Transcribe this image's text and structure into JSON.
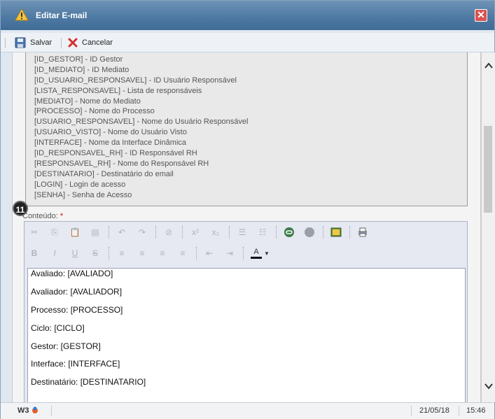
{
  "window": {
    "title": "Editar E-mail"
  },
  "toolbar": {
    "save_label": "Salvar",
    "cancel_label": "Cancelar"
  },
  "variables": [
    "[ID_GESTOR] - ID Gestor",
    "[ID_MEDIATO] - ID Mediato",
    "[ID_USUARIO_RESPONSAVEL] - ID Usuário Responsável",
    "[LISTA_RESPONSAVEL] - Lista de responsáveis",
    "[MEDIATO] - Nome do Mediato",
    "[PROCESSO] - Nome do Processo",
    "[USUARIO_RESPONSAVEL] - Nome do Usuário Responsável",
    "[USUARIO_VISTO] - Nome do Usuário Visto",
    "[INTERFACE] - Nome da Interface Dinâmica",
    "[ID_RESPONSAVEL_RH] - ID Responsável RH",
    "[RESPONSAVEL_RH] - Nome do Responsável RH",
    "[DESTINATARIO] - Destinatário do email",
    "[LOGIN] - Login de acesso",
    "[SENHA] - Senha de Acesso"
  ],
  "step_badge": "11",
  "content_field": {
    "label": "Conteúdo:",
    "required_marker": "*"
  },
  "editor_lines": [
    "Avaliado: [AVALIADO]",
    "Avaliador: [AVALIADOR]",
    "Processo: [PROCESSO]",
    "Ciclo: [CICLO]",
    "Gestor: [GESTOR]",
    "Interface: [INTERFACE]",
    "Destinatário: [DESTINATARIO]"
  ],
  "status": {
    "logo_text": "W3",
    "date": "21/05/18",
    "time": "15:46"
  },
  "colors": {
    "titlebar": "#4f7aa3",
    "close_button": "#d9534f",
    "required": "#dd0000",
    "badge": "#222222"
  }
}
